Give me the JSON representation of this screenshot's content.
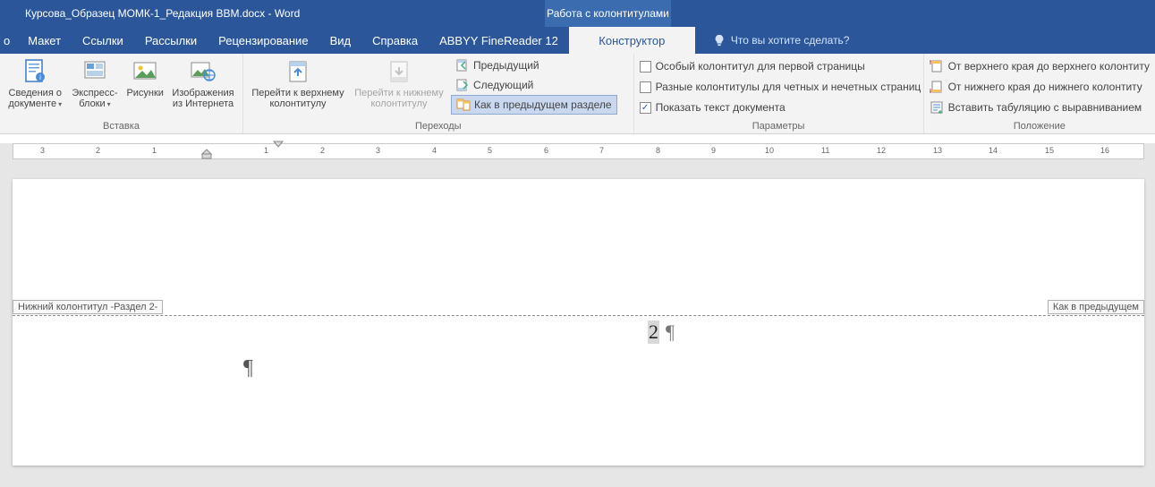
{
  "title": "Курсова_Образец МОМК-1_Редакция BBM.docx  -  Word",
  "context_tab": "Работа с колонтитулами",
  "tabs": [
    "о",
    "Макет",
    "Ссылки",
    "Рассылки",
    "Рецензирование",
    "Вид",
    "Справка",
    "ABBYY FineReader 12",
    "Конструктор"
  ],
  "tell_me": "Что вы хотите сделать?",
  "insert": {
    "doc_info": "Сведения о документе",
    "quick_parts": "Экспресс-блоки",
    "pictures": "Рисунки",
    "online_pics": "Изображения из Интернета",
    "group": "Вставка"
  },
  "nav": {
    "goto_header": "Перейти к верхнему колонтитулу",
    "goto_footer": "Перейти к нижнему колонтитулу",
    "previous": "Предыдущий",
    "next": "Следующий",
    "link_prev": "Как в предыдущем разделе",
    "group": "Переходы"
  },
  "options": {
    "diff_first": "Особый колонтитул для первой страницы",
    "diff_odd_even": "Разные колонтитулы для четных и нечетных страниц",
    "show_text": "Показать текст документа",
    "group": "Параметры"
  },
  "position": {
    "from_top": "От верхнего края до верхнего колонтиту",
    "from_bottom": "От нижнего края до нижнего колонтиту",
    "insert_tab": "Вставить табуляцию с выравниванием",
    "group": "Положение"
  },
  "page": {
    "footer_label": "Нижний колонтитул -Раздел 2-",
    "link_label": "Как в предыдущем",
    "number": "2"
  }
}
